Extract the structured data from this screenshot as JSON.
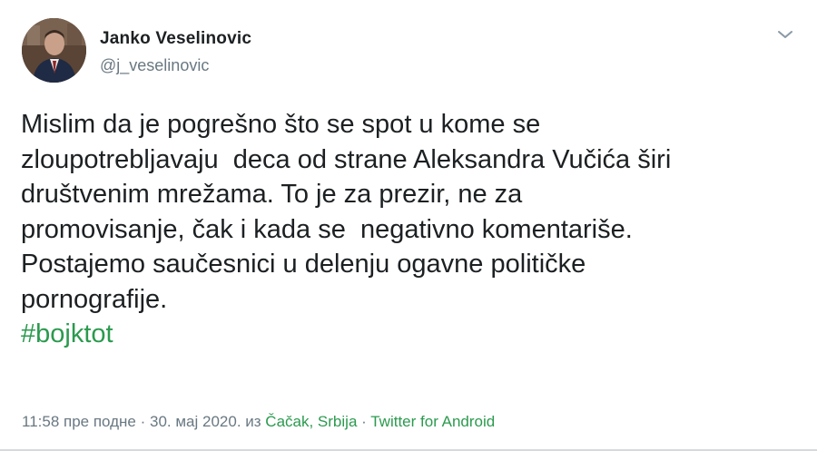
{
  "author": {
    "name": "Janko Veselinovic",
    "handle": "@j_veselinovic"
  },
  "tweet": {
    "lines": [
      "Mislim da je pogrešno što se spot u kome se",
      "zloupotrebljavaju  deca od strane Aleksandra Vučića širi",
      "društvenim mrežama. To je za prezir, ne za",
      "promovisanje, čak i kada se  negativno komentariše.",
      "Postajemo saučesnici u delenju ogavne političke",
      "pornografije."
    ],
    "hashtag": "#bojktot"
  },
  "meta": {
    "timestamp": "11:58 пре подне · 30. мај 2020. из",
    "location": "Čačak, Srbija",
    "separator": "·",
    "source": "Twitter for Android"
  },
  "colors": {
    "link": "#2b9a4e",
    "text": "#1c2022",
    "muted": "#697882"
  },
  "icons": {
    "menu": "chevron-down-icon",
    "avatar": "profile-photo"
  }
}
